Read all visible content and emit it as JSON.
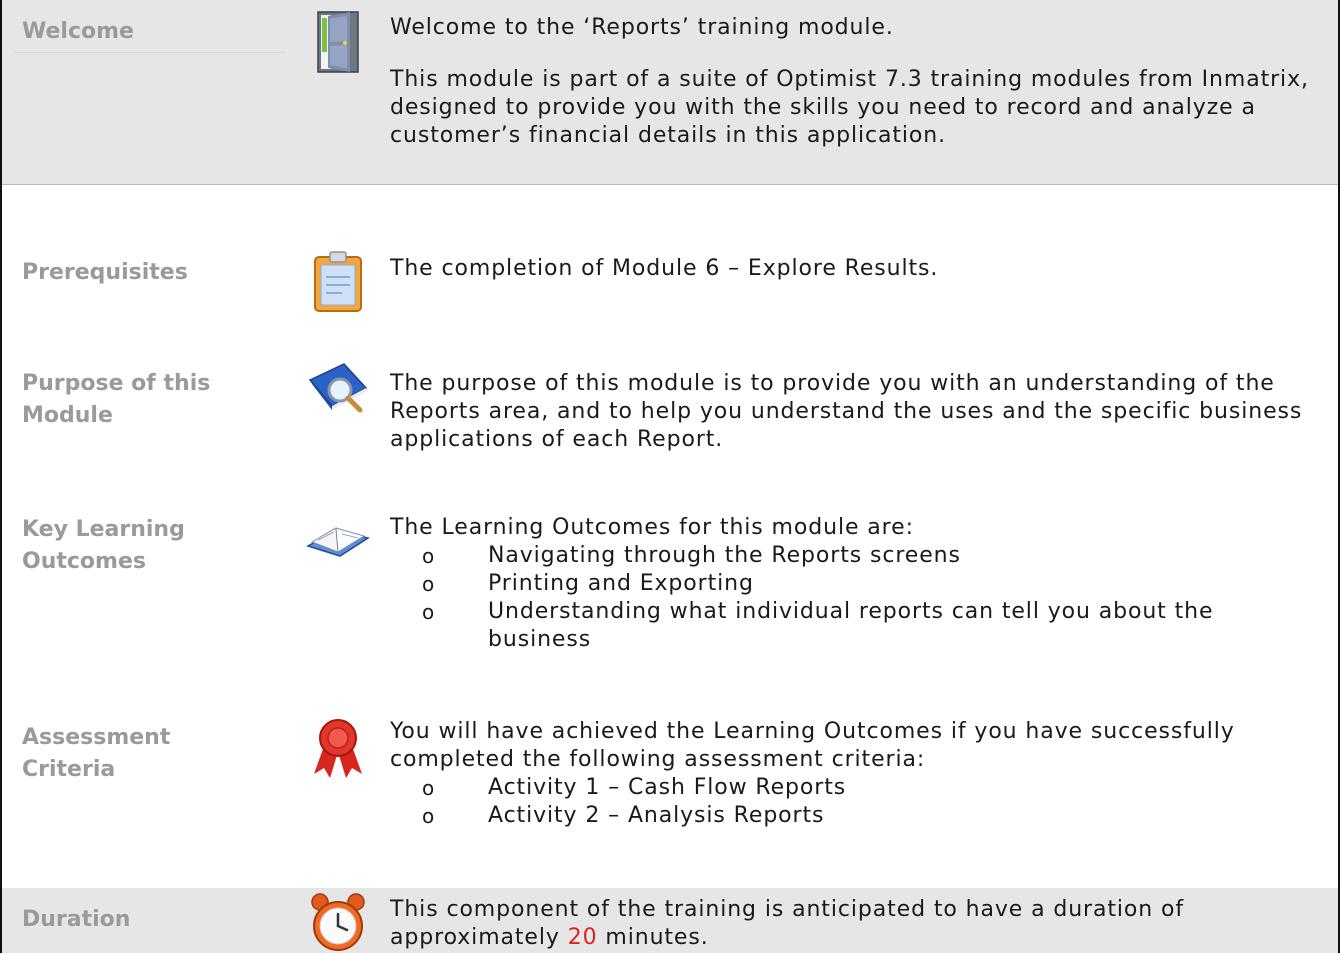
{
  "welcome": {
    "label": "Welcome",
    "intro": "Welcome to the ‘Reports’ training module.",
    "body": "This module is part of a suite of Optimist 7.3 training modules from Inmatrix, designed to provide you with the skills you need to record and analyze a customer’s financial details in this application.",
    "icon": "door-icon"
  },
  "prerequisites": {
    "label": "Prerequisites",
    "text": "The completion of Module 6 – Explore Results.",
    "icon": "clipboard-icon"
  },
  "purpose": {
    "label_line1": "Purpose of this",
    "label_line2": "Module",
    "text": "The purpose of this module is to provide you with an understanding of the Reports area, and to help you understand the uses and the specific business applications of each Report.",
    "icon": "book-magnifier-icon"
  },
  "outcomes": {
    "label_line1": "Key Learning",
    "label_line2": "Outcomes",
    "intro": "The Learning Outcomes for this module are:",
    "items": [
      "Navigating through the Reports screens",
      "Printing and Exporting",
      "Understanding what individual reports can tell you about the business"
    ],
    "icon": "open-book-icon"
  },
  "assessment": {
    "label_line1": "Assessment",
    "label_line2": "Criteria",
    "intro": "You will have achieved the Learning Outcomes if you have successfully completed the following assessment criteria:",
    "items": [
      "Activity 1 – Cash Flow Reports",
      "Activity 2 – Analysis Reports"
    ],
    "icon": "award-ribbon-icon"
  },
  "duration": {
    "label": "Duration",
    "text_before": "This component of the training is anticipated to have a duration of approximately ",
    "minutes": "20",
    "text_after": " minutes.",
    "icon": "alarm-clock-icon",
    "highlight_color": "#e02020"
  }
}
